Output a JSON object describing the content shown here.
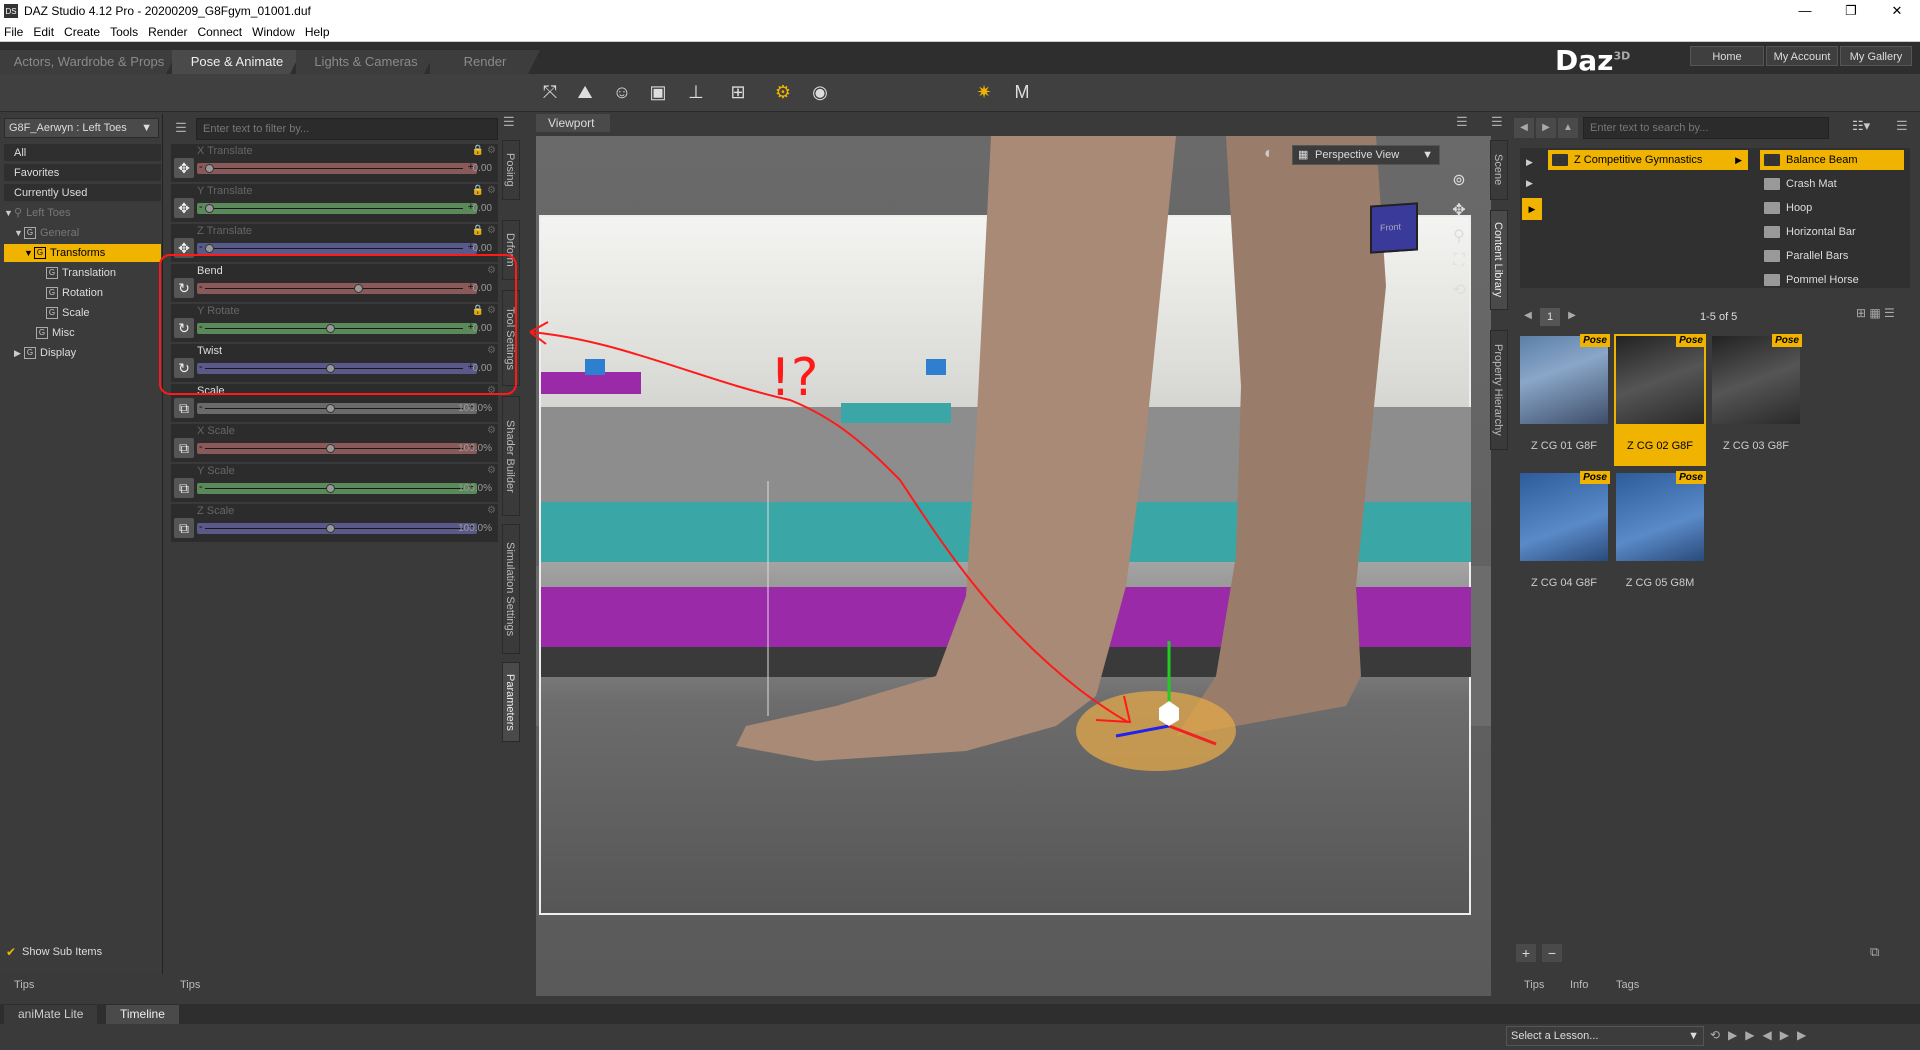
{
  "window": {
    "title": "DAZ Studio 4.12 Pro - 20200209_G8Fgym_01001.duf",
    "app_icon": "DS",
    "controls": [
      "—",
      "❐",
      "✕"
    ]
  },
  "menu": [
    "File",
    "Edit",
    "Create",
    "Tools",
    "Render",
    "Connect",
    "Window",
    "Help"
  ],
  "activity_tabs": [
    "Actors, Wardrobe & Props",
    "Pose & Animate",
    "Lights & Cameras",
    "Render"
  ],
  "brand": {
    "name": "Daz",
    "sup": "3D"
  },
  "top_buttons": [
    "Home",
    "My Account",
    "My Gallery"
  ],
  "left": {
    "node_selector": "G8F_Aerwyn : Left Toes",
    "favorites": [
      "All",
      "Favorites",
      "Currently Used"
    ],
    "tree": {
      "root": "Left Toes",
      "general": "General",
      "transforms": "Transforms",
      "translation": "Translation",
      "rotation": "Rotation",
      "scale": "Scale",
      "misc": "Misc",
      "display": "Display"
    },
    "show_sub_items": "Show Sub Items",
    "tips_tab": "Tips"
  },
  "params": {
    "filter_placeholder": "Enter text to filter by...",
    "sliders": [
      {
        "label": "X Translate",
        "value": "0.00",
        "knob": 0.05
      },
      {
        "label": "Y Translate",
        "value": "0.00",
        "knob": 0.05
      },
      {
        "label": "Z Translate",
        "value": "0.00",
        "knob": 0.05
      },
      {
        "label": "Bend",
        "value": "0.00",
        "knob": 0.6
      },
      {
        "label": "Y Rotate",
        "value": "0.00",
        "knob": 0.5
      },
      {
        "label": "Twist",
        "value": "0.00",
        "knob": 0.5
      },
      {
        "label": "Scale",
        "value": "100.0%",
        "knob": 0.5
      },
      {
        "label": "X Scale",
        "value": "100.0%",
        "knob": 0.5
      },
      {
        "label": "Y Scale",
        "value": "100.0%",
        "knob": 0.5
      },
      {
        "label": "Z Scale",
        "value": "100.0%",
        "knob": 0.5
      }
    ],
    "side_tabs": [
      "Posing",
      "Drform",
      "Tool Settings",
      "Shader Builder",
      "Simulation Settings",
      "Parameters"
    ],
    "tips_tab": "Tips"
  },
  "viewport": {
    "tab": "Viewport",
    "camera": "Perspective View",
    "cube_label": "Front"
  },
  "right": {
    "search_placeholder": "Enter text to search by...",
    "side_tabs": [
      "Scene",
      "Content Library",
      "Property Hierarchy"
    ],
    "category": "Z Competitive Gymnastics",
    "subcategories": [
      "Balance Beam",
      "Crash Mat",
      "Hoop",
      "Horizontal Bar",
      "Parallel Bars",
      "Pommel Horse"
    ],
    "page": "1",
    "count": "1-5 of 5",
    "badge": "Pose",
    "items": [
      "Z CG 01 G8F",
      "Z CG 02 G8F",
      "Z CG 03 G8F",
      "Z CG 04 G8F",
      "Z CG 05 G8M"
    ],
    "bottom_tabs": [
      "Tips",
      "Info",
      "Tags"
    ],
    "lesson_placeholder": "Select a Lesson..."
  },
  "bottom_tabs": [
    "aniMate Lite",
    "Timeline"
  ],
  "annotation": {
    "text": "!?",
    "color": "#ff1a1a"
  },
  "colors": {
    "accent": "#f0b400",
    "x_axis": "#8a5a5a",
    "y_axis": "#5a8a5a",
    "z_axis": "#5a5a8a"
  }
}
